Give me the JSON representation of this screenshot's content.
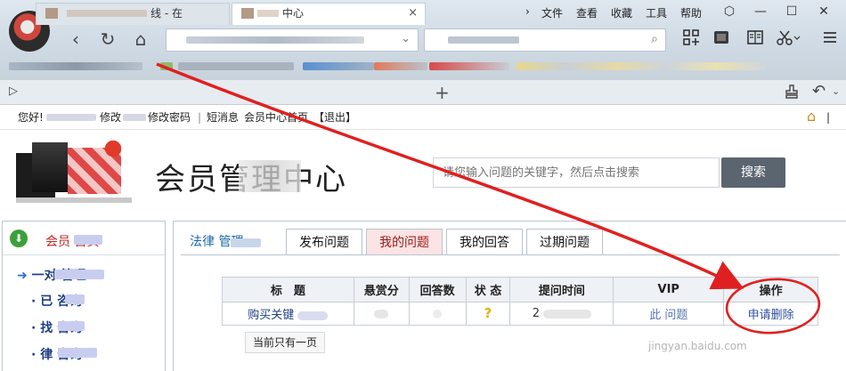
{
  "browser": {
    "menu": [
      "文件",
      "查看",
      "收藏",
      "工具",
      "帮助"
    ],
    "menu_chevron": "›",
    "window_controls": {
      "skin": "⬡",
      "minimize": "—",
      "maximize": "☐",
      "close": "✕"
    },
    "nav": {
      "back": "‹",
      "refresh": "↻",
      "home": "⌂"
    },
    "address_chevron": "⌄",
    "search_icon_glyph": "⌕",
    "toolbar_icons": [
      "grid-icon",
      "screenshot-icon",
      "reader-icon",
      "scissors-icon",
      "menu-icon"
    ],
    "tabs": [
      {
        "label": "线 - 在"
      },
      {
        "label": "中心"
      }
    ],
    "tab_close": "×",
    "new_tab": "+",
    "tab_bar_right": {
      "back": "⌂",
      "undo": "↶"
    }
  },
  "userbar": {
    "greeting": "您好!",
    "modify": "修改",
    "change_password": "修改密码",
    "short_message": "短消息",
    "member_home": "会员中心首页",
    "logout": "【退出】"
  },
  "header": {
    "title": "会员管理中心",
    "search_placeholder": "请您输入问题的关键字，然后点击搜索",
    "search_button": "搜索"
  },
  "sidebar": {
    "home_label": "会员   首页",
    "items": [
      {
        "label": "一对     管理"
      },
      {
        "label": "· 已    咨询"
      },
      {
        "label": "· 找     咨询"
      },
      {
        "label": "· 律      咨询"
      }
    ]
  },
  "content": {
    "tabs": [
      "法律    管理",
      "发布问题",
      "我的问题",
      "我的回答",
      "过期问题"
    ],
    "active_tab_index": 2,
    "table": {
      "headers": [
        "标　题",
        "悬赏分",
        "回答数",
        "状 态",
        "提问时间",
        "VIP",
        "操作"
      ],
      "rows": [
        {
          "title": "购买关键",
          "reward": "",
          "answers": "",
          "status": "?",
          "time": "2",
          "vip": "此     问题",
          "action": "申请删除"
        }
      ]
    },
    "pager": "当前只有一页"
  },
  "watermark": "jingyan.baidu.com",
  "colors": {
    "annotation_red": "#e02020",
    "active_tab_bg": "#fde4e4",
    "link_blue": "#1d3e82"
  }
}
